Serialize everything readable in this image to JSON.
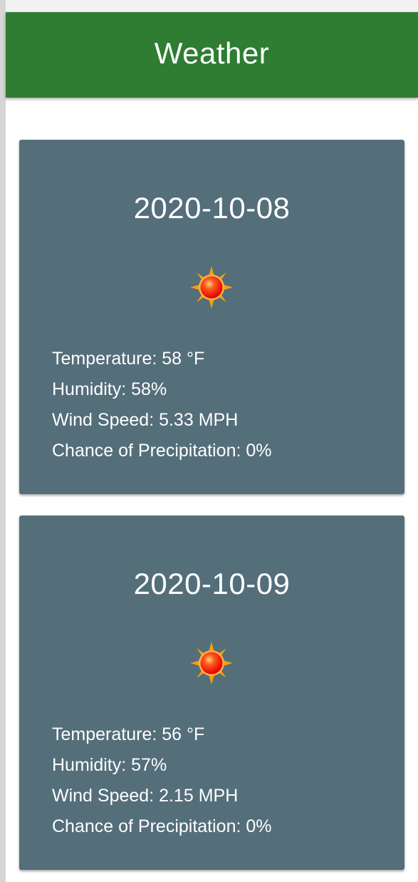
{
  "header": {
    "title": "Weather"
  },
  "forecast": [
    {
      "date": "2020-10-08",
      "icon": "sun-icon",
      "temperature": "Temperature: 58 °F",
      "humidity": "Humidity: 58%",
      "wind_speed": "Wind Speed: 5.33 MPH",
      "precipitation": "Chance of Precipitation: 0%"
    },
    {
      "date": "2020-10-09",
      "icon": "sun-icon",
      "temperature": "Temperature: 56 °F",
      "humidity": "Humidity: 57%",
      "wind_speed": "Wind Speed: 2.15 MPH",
      "precipitation": "Chance of Precipitation: 0%"
    }
  ],
  "colors": {
    "header_bg": "#2e7d32",
    "card_bg": "#546e7a",
    "text": "#ffffff",
    "sun_core": "#ff2a00",
    "sun_rays": "#f59e0b"
  }
}
